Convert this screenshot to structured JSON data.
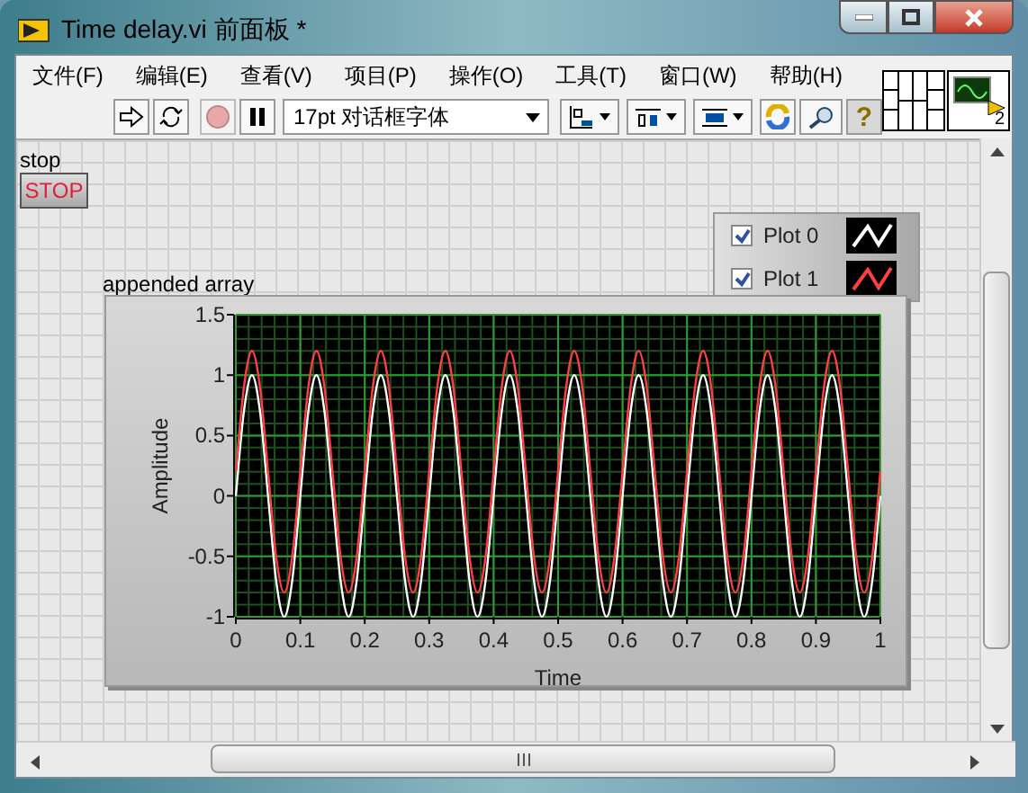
{
  "window": {
    "title": "Time delay.vi 前面板 *"
  },
  "menu": [
    "文件(F)",
    "编辑(E)",
    "查看(V)",
    "项目(P)",
    "操作(O)",
    "工具(T)",
    "窗口(W)",
    "帮助(H)"
  ],
  "toolbar": {
    "font": "17pt 对话框字体",
    "help": "?",
    "connector_pane_number": "2"
  },
  "stop_control": {
    "label": "stop",
    "button": "STOP"
  },
  "graph": {
    "label": "appended array",
    "legend": [
      {
        "checked": true
      },
      {
        "checked": true
      }
    ],
    "chart_data": {
      "type": "line",
      "grid": true,
      "xlabel": "Time",
      "ylabel": "Amplitude",
      "xlim": [
        0,
        1
      ],
      "ylim": [
        -1,
        1.5
      ],
      "xticks": [
        {
          "value": 0,
          "label": "0"
        },
        {
          "value": 0.1,
          "label": "0.1"
        },
        {
          "value": 0.2,
          "label": "0.2"
        },
        {
          "value": 0.3,
          "label": "0.3"
        },
        {
          "value": 0.4,
          "label": "0.4"
        },
        {
          "value": 0.5,
          "label": "0.5"
        },
        {
          "value": 0.6,
          "label": "0.6"
        },
        {
          "value": 0.7,
          "label": "0.7"
        },
        {
          "value": 0.8,
          "label": "0.8"
        },
        {
          "value": 0.9,
          "label": "0.9"
        },
        {
          "value": 1,
          "label": "1"
        }
      ],
      "yticks": [
        {
          "value": -1,
          "label": "-1"
        },
        {
          "value": -0.5,
          "label": "-0.5"
        },
        {
          "value": 0,
          "label": "0"
        },
        {
          "value": 0.5,
          "label": "0.5"
        },
        {
          "value": 1,
          "label": "1"
        },
        {
          "value": 1.5,
          "label": "1.5"
        }
      ],
      "x": [
        0,
        0.0125,
        0.025,
        0.0375,
        0.05,
        0.0625,
        0.075,
        0.0875,
        0.1,
        0.1125,
        0.125,
        0.1375,
        0.15,
        0.1625,
        0.175,
        0.1875,
        0.2,
        0.2125,
        0.225,
        0.2375,
        0.25,
        0.2625,
        0.275,
        0.2875,
        0.3,
        0.3125,
        0.325,
        0.3375,
        0.35,
        0.3625,
        0.375,
        0.3875,
        0.4,
        0.4125,
        0.425,
        0.4375,
        0.45,
        0.4625,
        0.475,
        0.4875,
        0.5,
        0.5125,
        0.525,
        0.5375,
        0.55,
        0.5625,
        0.575,
        0.5875,
        0.6,
        0.6125,
        0.625,
        0.6375,
        0.65,
        0.6625,
        0.675,
        0.6875,
        0.7,
        0.7125,
        0.725,
        0.7375,
        0.75,
        0.7625,
        0.775,
        0.7875,
        0.8,
        0.8125,
        0.825,
        0.8375,
        0.85,
        0.8625,
        0.875,
        0.8875,
        0.9,
        0.9125,
        0.925,
        0.9375,
        0.95,
        0.9625,
        0.975,
        0.9875,
        1
      ],
      "series": [
        {
          "name": "Plot 0",
          "color": "#ffffff",
          "values": [
            0,
            0.7,
            1,
            0.7,
            0,
            -0.7,
            -1,
            -0.7,
            0,
            0.7,
            1,
            0.7,
            0,
            -0.7,
            -1,
            -0.7,
            0,
            0.7,
            1,
            0.7,
            0,
            -0.7,
            -1,
            -0.7,
            0,
            0.7,
            1,
            0.7,
            0,
            -0.7,
            -1,
            -0.7,
            0,
            0.7,
            1,
            0.7,
            0,
            -0.7,
            -1,
            -0.7,
            0,
            0.7,
            1,
            0.7,
            0,
            -0.7,
            -1,
            -0.7,
            0,
            0.7,
            1,
            0.7,
            0,
            -0.7,
            -1,
            -0.7,
            0,
            0.7,
            1,
            0.7,
            0,
            -0.7,
            -1,
            -0.7,
            0,
            0.7,
            1,
            0.7,
            0,
            -0.7,
            -1,
            -0.7,
            0,
            0.7,
            1,
            0.7,
            0,
            -0.7,
            -1,
            -0.7,
            0
          ]
        },
        {
          "name": "Plot 1",
          "color": "#ff4040",
          "values": [
            0.2,
            0.9,
            1.2,
            0.9,
            0.2,
            -0.5,
            -0.8,
            -0.5,
            0.2,
            0.9,
            1.2,
            0.9,
            0.2,
            -0.5,
            -0.8,
            -0.5,
            0.2,
            0.9,
            1.2,
            0.9,
            0.2,
            -0.5,
            -0.8,
            -0.5,
            0.2,
            0.9,
            1.2,
            0.9,
            0.2,
            -0.5,
            -0.8,
            -0.5,
            0.2,
            0.9,
            1.2,
            0.9,
            0.2,
            -0.5,
            -0.8,
            -0.5,
            0.2,
            0.9,
            1.2,
            0.9,
            0.2,
            -0.5,
            -0.8,
            -0.5,
            0.2,
            0.9,
            1.2,
            0.9,
            0.2,
            -0.5,
            -0.8,
            -0.5,
            0.2,
            0.9,
            1.2,
            0.9,
            0.2,
            -0.5,
            -0.8,
            -0.5,
            0.2,
            0.9,
            1.2,
            0.9,
            0.2,
            -0.5,
            -0.8,
            -0.5,
            0.2,
            0.9,
            1.2,
            0.9,
            0.2,
            -0.5,
            -0.8,
            -0.5,
            0.2
          ]
        }
      ]
    }
  }
}
